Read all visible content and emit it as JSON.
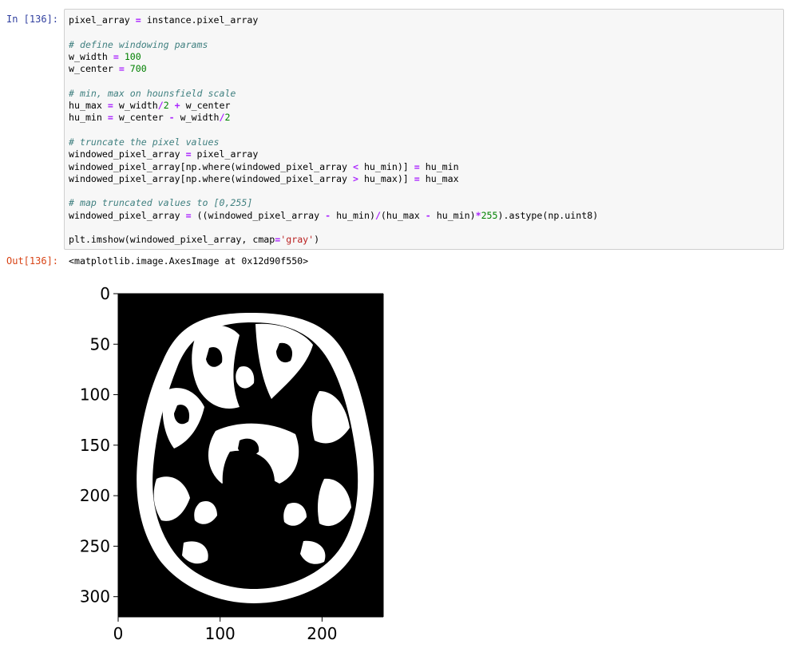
{
  "cell": {
    "in_prompt": "In [136]:",
    "out_prompt": "Out[136]:",
    "output_text": "<matplotlib.image.AxesImage at 0x12d90f550>",
    "code_lines": [
      [
        [
          "pixel_array ",
          ""
        ],
        [
          "=",
          "op"
        ],
        [
          " instance.pixel_array",
          ""
        ]
      ],
      [],
      [
        [
          "# define windowing params",
          "cm"
        ]
      ],
      [
        [
          "w_width ",
          ""
        ],
        [
          "=",
          "op"
        ],
        [
          " ",
          ""
        ],
        [
          "100",
          "num"
        ]
      ],
      [
        [
          "w_center ",
          ""
        ],
        [
          "=",
          "op"
        ],
        [
          " ",
          ""
        ],
        [
          "700",
          "num"
        ]
      ],
      [],
      [
        [
          "# min, max on hounsfield scale",
          "cm"
        ]
      ],
      [
        [
          "hu_max ",
          ""
        ],
        [
          "=",
          "op"
        ],
        [
          " w_width",
          ""
        ],
        [
          "/",
          "op"
        ],
        [
          "2",
          "num"
        ],
        [
          " ",
          ""
        ],
        [
          "+",
          "op"
        ],
        [
          " w_center",
          ""
        ]
      ],
      [
        [
          "hu_min ",
          ""
        ],
        [
          "=",
          "op"
        ],
        [
          " w_center ",
          ""
        ],
        [
          "-",
          "op"
        ],
        [
          " w_width",
          ""
        ],
        [
          "/",
          "op"
        ],
        [
          "2",
          "num"
        ]
      ],
      [],
      [
        [
          "# truncate the pixel values",
          "cm"
        ]
      ],
      [
        [
          "windowed_pixel_array ",
          ""
        ],
        [
          "=",
          "op"
        ],
        [
          " pixel_array",
          ""
        ]
      ],
      [
        [
          "windowed_pixel_array[np.where(windowed_pixel_array ",
          ""
        ],
        [
          "<",
          "op"
        ],
        [
          " hu_min)] ",
          ""
        ],
        [
          "=",
          "op"
        ],
        [
          " hu_min",
          ""
        ]
      ],
      [
        [
          "windowed_pixel_array[np.where(windowed_pixel_array ",
          ""
        ],
        [
          ">",
          "op"
        ],
        [
          " hu_max)] ",
          ""
        ],
        [
          "=",
          "op"
        ],
        [
          " hu_max",
          ""
        ]
      ],
      [],
      [
        [
          "# map truncated values to [0,255]",
          "cm"
        ]
      ],
      [
        [
          "windowed_pixel_array ",
          ""
        ],
        [
          "=",
          "op"
        ],
        [
          " ((windowed_pixel_array ",
          ""
        ],
        [
          "-",
          "op"
        ],
        [
          " hu_min)",
          ""
        ],
        [
          "/",
          "op"
        ],
        [
          "(hu_max ",
          ""
        ],
        [
          "-",
          "op"
        ],
        [
          " hu_min)",
          ""
        ],
        [
          "*",
          "op"
        ],
        [
          "255",
          "num"
        ],
        [
          ").astype(np.uint8)",
          ""
        ]
      ],
      [],
      [
        [
          "plt.imshow(windowed_pixel_array, cmap",
          ""
        ],
        [
          "=",
          "op"
        ],
        [
          "'gray'",
          "str"
        ],
        [
          ")",
          ""
        ]
      ]
    ]
  },
  "plot": {
    "image_width": 260,
    "image_height": 320,
    "x_ticks": [
      "0",
      "100",
      "200"
    ],
    "y_ticks": [
      "0",
      "50",
      "100",
      "150",
      "200",
      "250",
      "300"
    ],
    "x_tick_values": [
      0,
      100,
      200
    ],
    "y_tick_values": [
      0,
      50,
      100,
      150,
      200,
      250,
      300
    ],
    "colors": {
      "image_bg": "#000000",
      "bone": "#ffffff"
    }
  }
}
